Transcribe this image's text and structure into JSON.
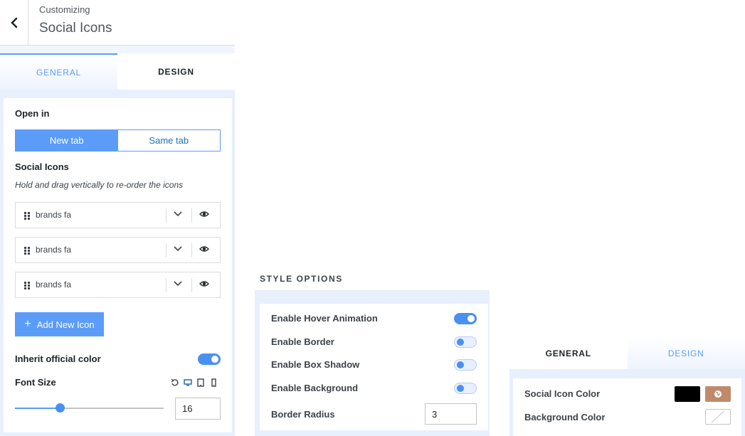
{
  "header": {
    "subtitle": "Customizing",
    "title": "Social Icons"
  },
  "left_tabs": [
    {
      "label": "GENERAL",
      "active": true
    },
    {
      "label": "DESIGN",
      "active": false
    }
  ],
  "open_in": {
    "label": "Open in",
    "options": [
      "New tab",
      "Same tab"
    ],
    "selected": "New tab"
  },
  "social_icons": {
    "label": "Social Icons",
    "hint": "Hold and drag vertically to re-order the icons",
    "items": [
      {
        "name": "brands fa"
      },
      {
        "name": "brands fa"
      },
      {
        "name": "brands fa"
      }
    ],
    "add_label": "Add New Icon"
  },
  "inherit_color": {
    "label": "Inherit official color",
    "enabled": true
  },
  "font_size": {
    "label": "Font Size",
    "value": "16",
    "slider_fraction": 0.3
  },
  "style_options": {
    "title": "STYLE OPTIONS",
    "toggles": [
      {
        "label": "Enable Hover Animation",
        "enabled": true
      },
      {
        "label": "Enable Border",
        "enabled": false
      },
      {
        "label": "Enable Box Shadow",
        "enabled": false
      },
      {
        "label": "Enable Background",
        "enabled": false
      }
    ],
    "border_radius": {
      "label": "Border Radius",
      "value": "3"
    }
  },
  "right_tabs": [
    {
      "label": "GENERAL",
      "active": true
    },
    {
      "label": "DESIGN",
      "active": false
    }
  ],
  "colors": {
    "social_icon_color_label": "Social Icon Color",
    "background_color_label": "Background Color",
    "social_icon_color": "#000000",
    "hover_swatch_color": "#c08a6a",
    "accent": "#5b9cf8"
  }
}
